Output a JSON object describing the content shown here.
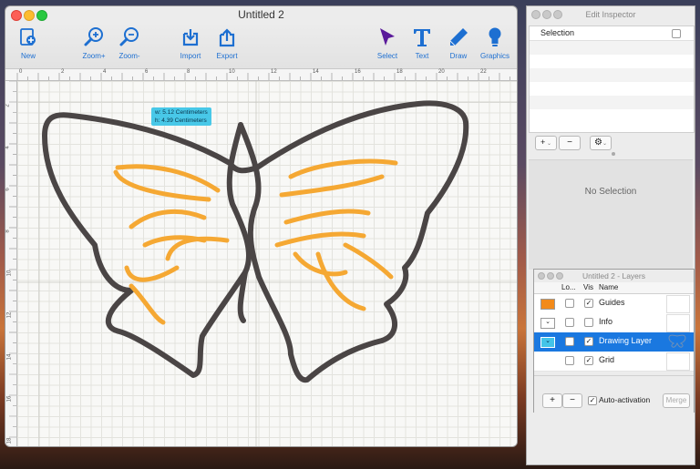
{
  "main": {
    "title": "Untitled 2",
    "toolbar": {
      "new": "New",
      "zoom_in": "Zoom+",
      "zoom_out": "Zoom-",
      "import": "Import",
      "export": "Export",
      "select": "Select",
      "text": "Text",
      "draw": "Draw",
      "graphics": "Graphics"
    },
    "ruler_top": [
      "0",
      "2",
      "4",
      "6",
      "8",
      "10",
      "12",
      "14",
      "16",
      "18",
      "20",
      "22",
      "24"
    ],
    "ruler_left": [
      "2",
      "4",
      "6",
      "8",
      "10",
      "12",
      "14",
      "16",
      "18"
    ],
    "tooltip": {
      "width": "w: 5.12 Centimeters",
      "height": "h: 4.39 Centimeters"
    }
  },
  "inspector": {
    "title": "Edit Inspector",
    "header": "Selection",
    "add": "+",
    "remove": "−",
    "empty": "No Selection"
  },
  "layers": {
    "title": "Untitled 2 - Layers",
    "col_lock": "Lo...",
    "col_vis": "Vis",
    "col_name": "Name",
    "rows": [
      {
        "name": "Guides",
        "swatch": "#f28a1a",
        "locked": false,
        "visible": true
      },
      {
        "name": "Info",
        "swatch": "#ffffff",
        "locked": false,
        "visible": false
      },
      {
        "name": "Drawing Layer",
        "swatch": "#43c4e8",
        "locked": false,
        "visible": true
      },
      {
        "name": "Grid",
        "swatch": "",
        "locked": false,
        "visible": true
      }
    ],
    "add": "+",
    "remove": "−",
    "auto_activation": "Auto-activation",
    "merge": "Merge"
  },
  "colors": {
    "accent": "#1d6fd1",
    "selection_row": "#1a78e0",
    "butterfly_outline": "#4a4545",
    "butterfly_fill": "#f5a833"
  }
}
